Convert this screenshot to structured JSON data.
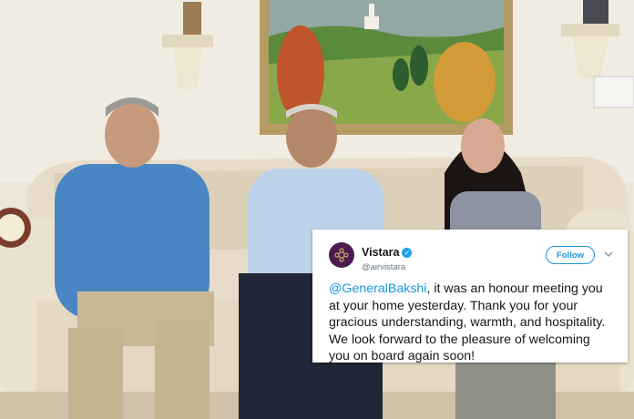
{
  "tweet": {
    "display_name": "Vistara",
    "handle": "@airvistara",
    "follow_label": "Follow",
    "mention": "@GeneralBakshi",
    "text": ", it was an honour meeting you at your home yesterday. Thank you for your gracious understanding, warmth, and hospitality. We look forward to the pleasure of welcoming you on board again soon!",
    "verified_icon": "verified-badge-icon",
    "avatar_icon": "vistara-logo-icon",
    "chevron_icon": "chevron-down-icon"
  },
  "colors": {
    "link": "#1b95e0",
    "brand": "#4b1c4f",
    "text": "#14171a",
    "handle": "#657786"
  }
}
